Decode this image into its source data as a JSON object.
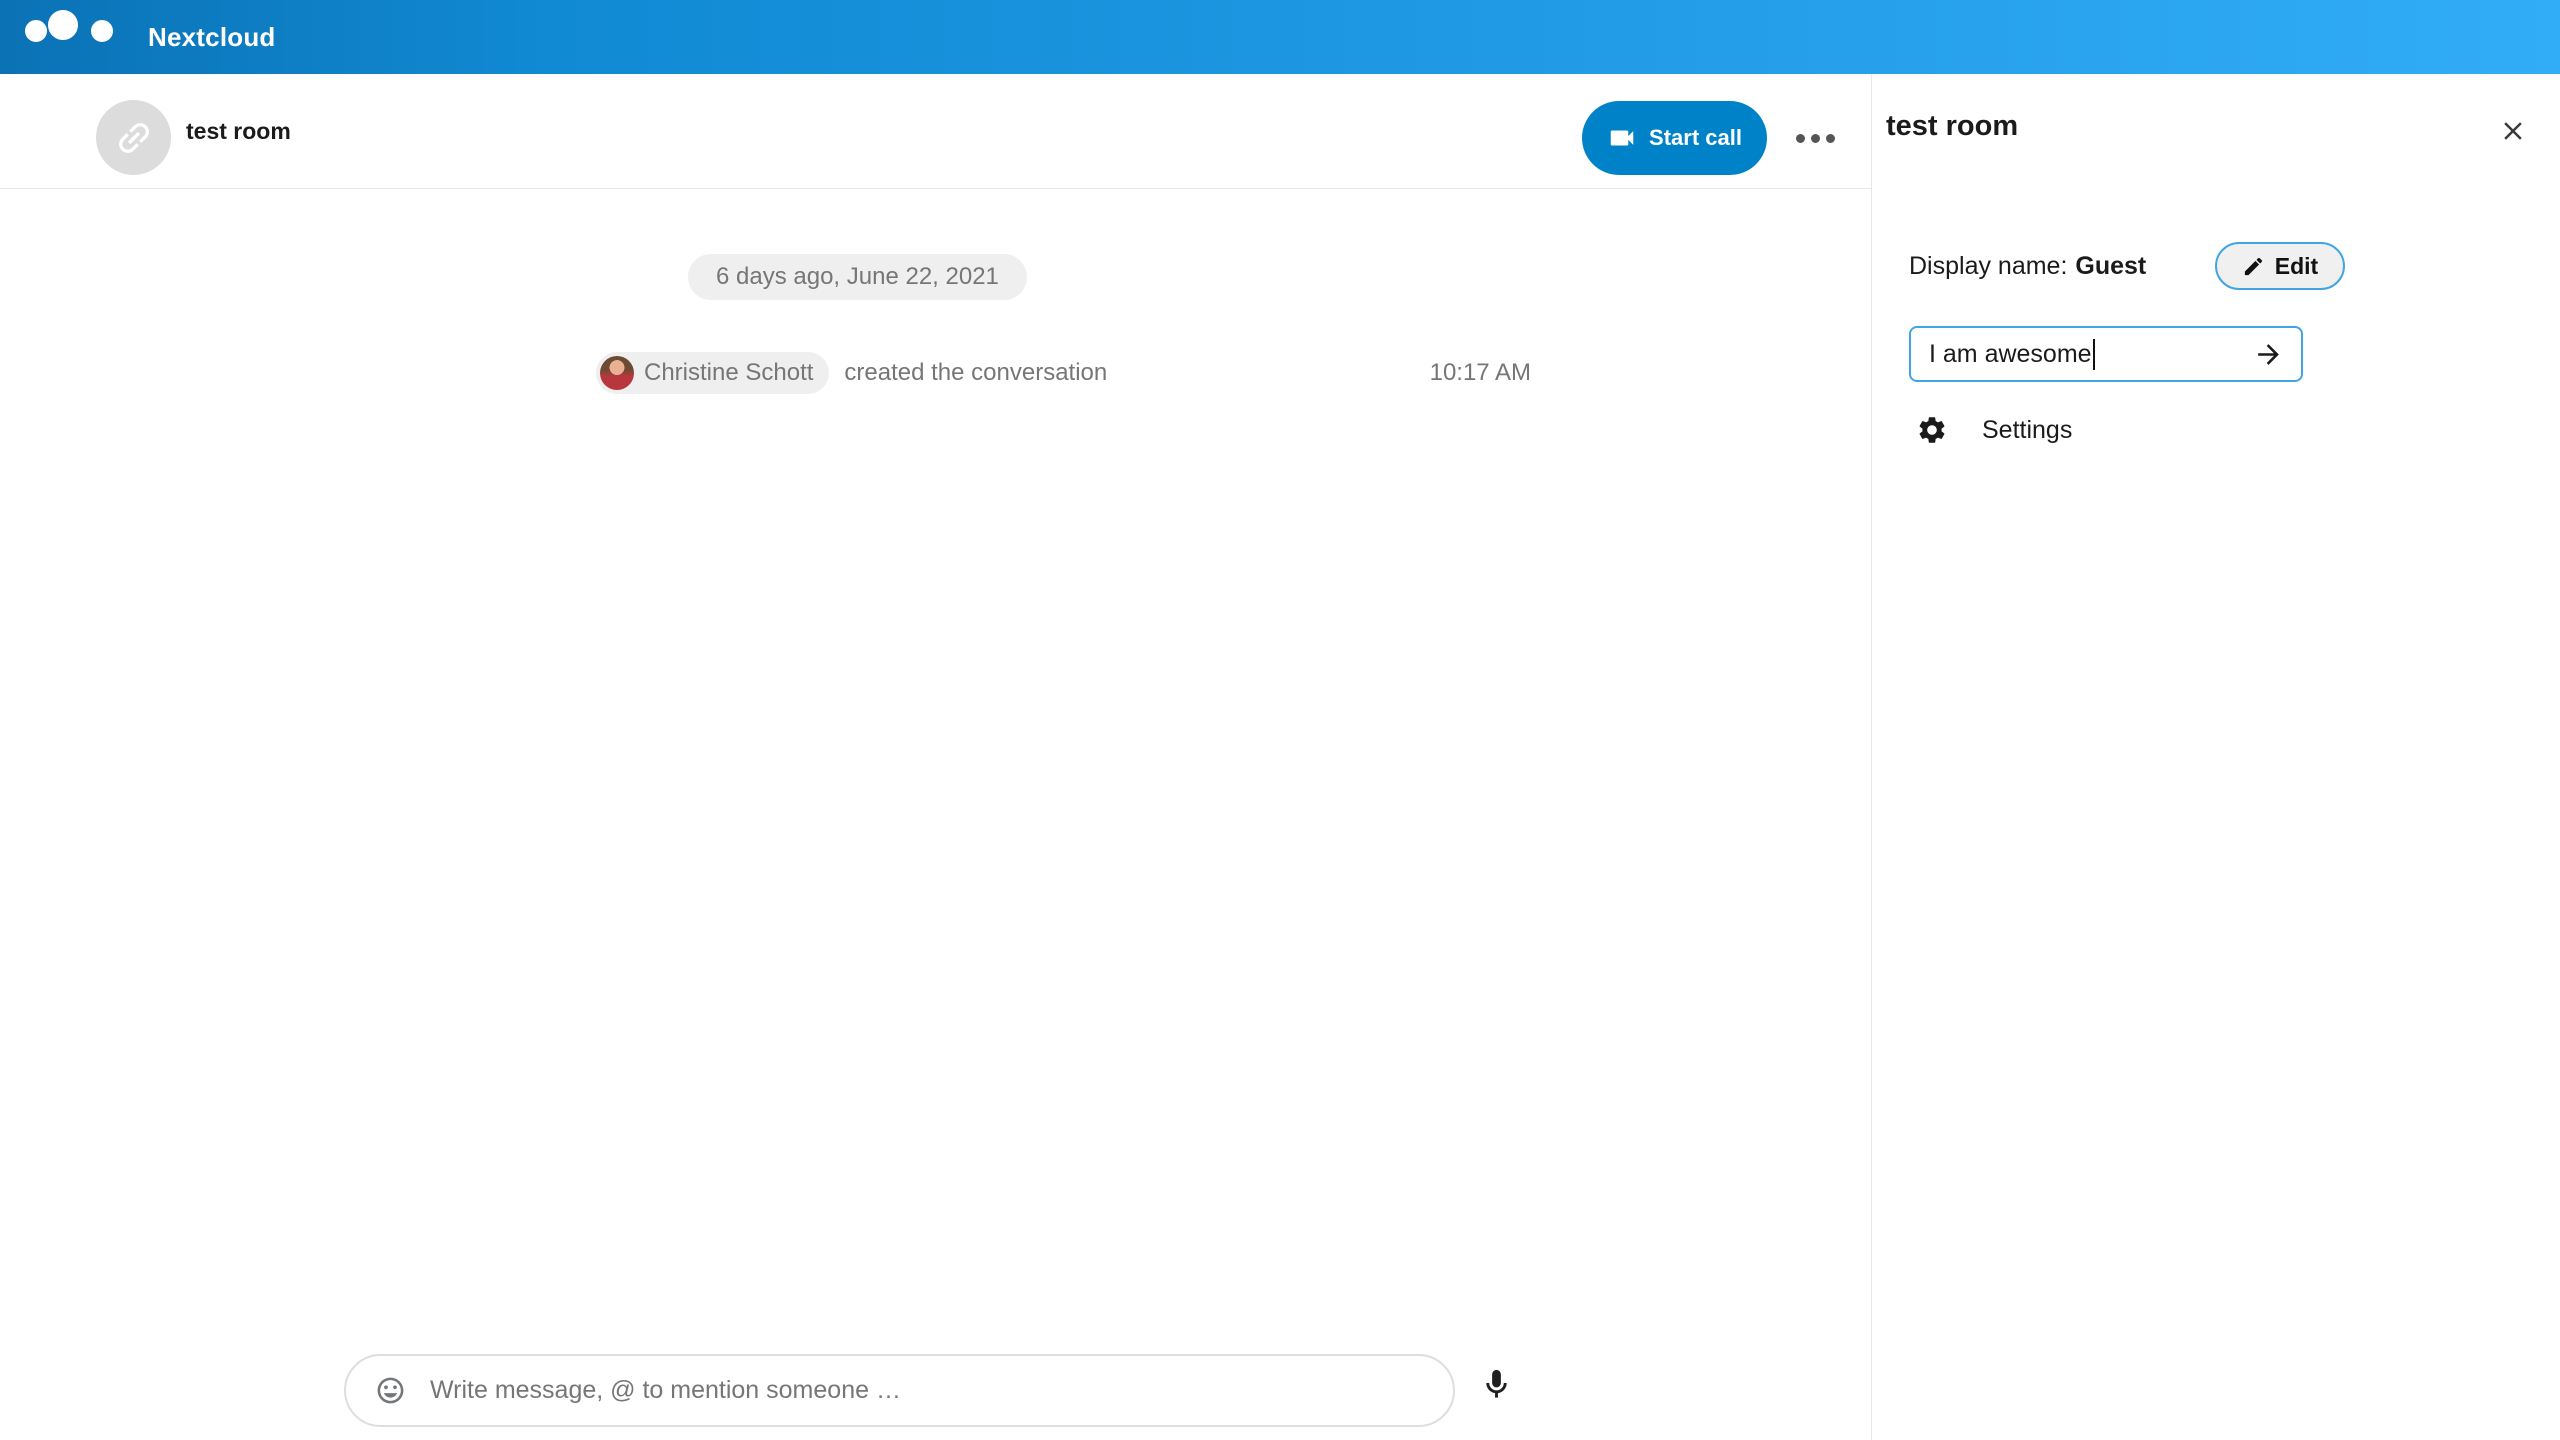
{
  "topbar": {
    "app_name": "Nextcloud"
  },
  "chat": {
    "header": {
      "title": "test room",
      "start_call_label": "Start call",
      "more_menu": "more-options"
    },
    "date_separator": "6 days ago, June 22, 2021",
    "system_message": {
      "author": "Christine Schott",
      "text": "created the conversation",
      "time": "10:17 AM"
    },
    "composer": {
      "placeholder": "Write message, @ to mention someone …"
    }
  },
  "sidebar": {
    "title": "test room",
    "display_name": {
      "label": "Display name:",
      "value": "Guest",
      "edit_label": "Edit"
    },
    "name_input": {
      "value": "I am awesome"
    },
    "settings_label": "Settings"
  },
  "colors": {
    "header_gradient_start": "#0b72b5",
    "header_gradient_end": "#31acf6",
    "primary_blue": "#0082c9",
    "input_border_blue": "#42a5e1",
    "muted_text": "#767676",
    "pill_background": "#efefef",
    "divider": "#e8e8e8"
  }
}
